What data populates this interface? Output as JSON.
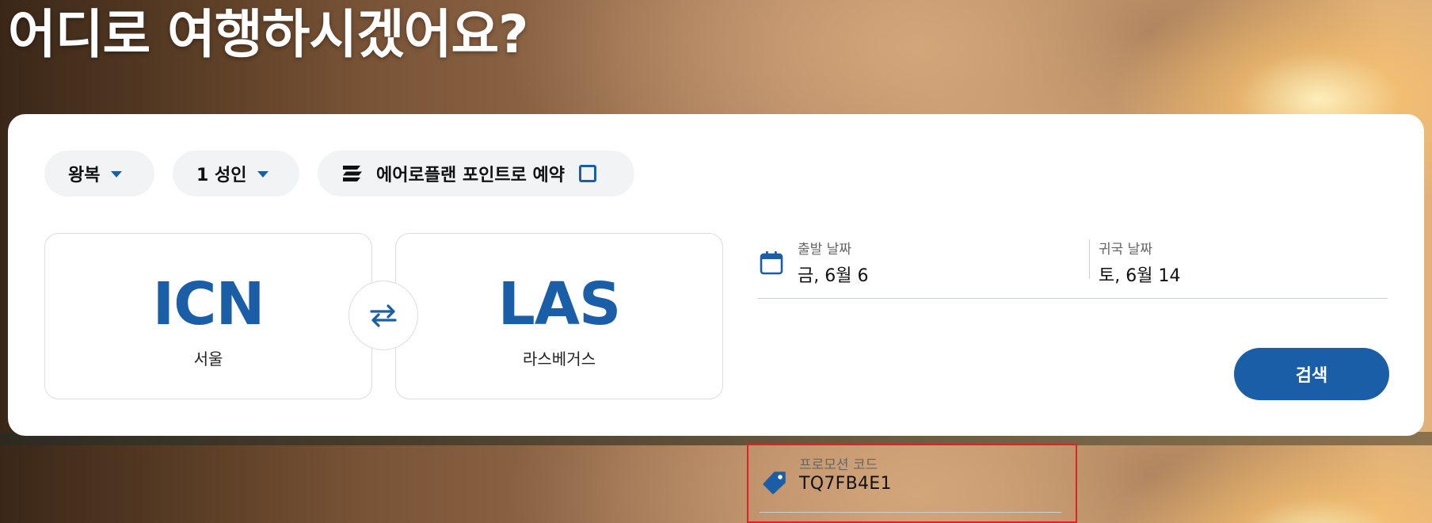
{
  "hero": {
    "title": "어디로 여행하시겠어요?"
  },
  "options": {
    "trip_type": "왕복",
    "passengers": "1 성인",
    "points_label": "에어로플랜 포인트로 예약"
  },
  "origin": {
    "code": "ICN",
    "city": "서울"
  },
  "destination": {
    "code": "LAS",
    "city": "라스베거스"
  },
  "dates": {
    "depart_label": "출발 날짜",
    "depart_value": "금, 6월 6",
    "return_label": "귀국 날짜",
    "return_value": "토, 6월 14"
  },
  "promo": {
    "label": "프로모션 코드",
    "value": "TQ7FB4E1"
  },
  "search_button": "검색",
  "colors": {
    "accent": "#1a5ea8",
    "highlight_border": "#e0202a"
  },
  "icons": {
    "trip_type_caret": "chevron-down-icon",
    "passengers_caret": "chevron-down-icon",
    "points_logo": "aeroplan-logo-icon",
    "swap": "swap-arrows-icon",
    "calendar": "calendar-icon",
    "promo": "tag-icon"
  }
}
